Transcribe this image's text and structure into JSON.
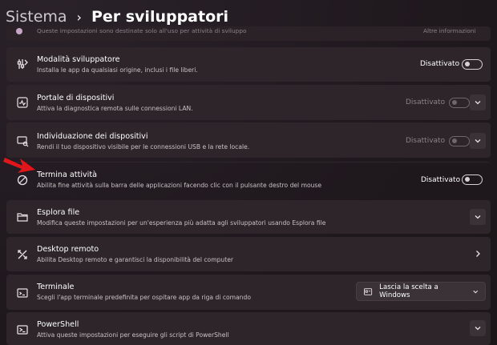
{
  "breadcrumb": {
    "parent": "Sistema",
    "separator": "›",
    "current": "Per sviluppatori"
  },
  "partial_row": {
    "text": "Queste impostazioni sono destinate solo all'uso per attività di sviluppo",
    "link": "Altre informazioni"
  },
  "rows": [
    {
      "icon": "developer-tools-icon",
      "title": "Modalità sviluppatore",
      "subtitle": "Installa le app da qualsiasi origine, inclusi i file liberi.",
      "toggle_label": "Disattivato",
      "toggle_on": false
    },
    {
      "icon": "device-portal-icon",
      "title": "Portale di dispositivi",
      "subtitle": "Attiva la diagnostica remota sulle connessioni LAN.",
      "toggle_label": "Disattivato",
      "toggle_on": false,
      "disabled": true
    },
    {
      "icon": "device-discovery-icon",
      "title": "Individuazione dei dispositivi",
      "subtitle": "Rendi il tuo dispositivo visibile per le connessioni USB e la rete locale.",
      "toggle_label": "Disattivato",
      "toggle_on": false,
      "disabled": true
    },
    {
      "icon": "end-task-icon",
      "title": "Termina attività",
      "subtitle": "Abilita fine attività sulla barra delle applicazioni facendo clic con il pulsante destro del mouse",
      "toggle_label": "Disattivato",
      "toggle_on": false
    },
    {
      "icon": "folder-icon",
      "title": "Esplora file",
      "subtitle": "Modifica queste impostazioni per un'esperienza più adatta agli sviluppatori usando Esplora file"
    },
    {
      "icon": "remote-desktop-icon",
      "title": "Desktop remoto",
      "subtitle": "Abilita Desktop remoto e garantisci la disponibilità del computer"
    },
    {
      "icon": "terminal-icon",
      "title": "Terminale",
      "subtitle": "Scegli l'app terminale predefinita per ospitare app da riga di comando",
      "dropdown_value": "Lascia la scelta a Windows"
    },
    {
      "icon": "powershell-icon",
      "title": "PowerShell",
      "subtitle": "Attiva queste impostazioni per eseguire gli script di PowerShell"
    }
  ],
  "colors": {
    "background": "#20191d",
    "card": "#2d2529",
    "annotation_arrow": "#e0161b"
  }
}
